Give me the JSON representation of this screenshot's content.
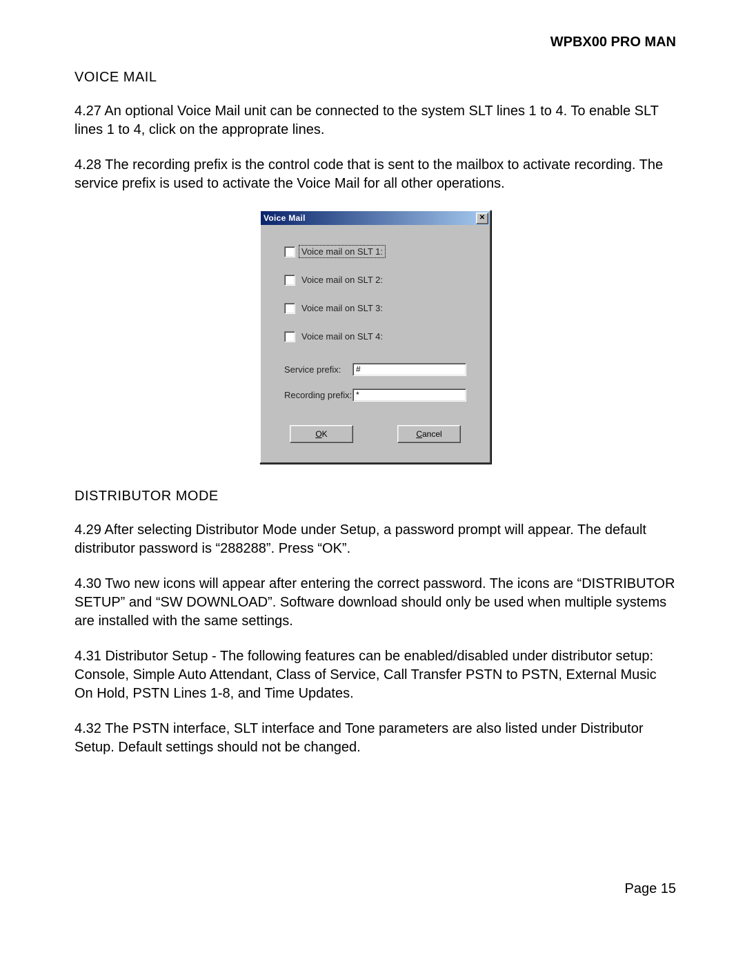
{
  "header": {
    "title": "WPBX00 PRO MAN"
  },
  "sections": {
    "voiceMail": {
      "title": "VOICE MAIL",
      "p427": "4.27    An optional Voice Mail unit can be connected to the system SLT lines 1 to 4.  To enable SLT lines 1 to 4, click on the approprate lines.",
      "p428": "4.28    The recording prefix is the control code  that is sent to the mailbox to activate recording.  The service prefix is used to activate the Voice Mail for all other operations."
    },
    "distributor": {
      "title": "DISTRIBUTOR MODE",
      "p429": "4.29    After selecting Distributor Mode under Setup, a password prompt will appear.  The default distributor password is “288288”.  Press “OK”.",
      "p430": "4.30    Two new icons will appear after entering the correct password.  The icons are “DISTRIBUTOR SETUP” and “SW DOWNLOAD”.  Software download should only be used when multiple systems are installed with the same settings.",
      "p431": "4.31    Distributor Setup - The following features can be enabled/disabled under distributor setup:  Console, Simple Auto Attendant, Class of Service, Call Transfer PSTN to PSTN, External Music On Hold, PSTN Lines 1-8, and Time Updates.",
      "p432": "4.32  The PSTN interface, SLT interface and Tone parameters are also listed under Distributor Setup.  Default settings should not be changed."
    }
  },
  "dialog": {
    "title": "Voice Mail",
    "close": "✕",
    "checkboxes": [
      {
        "label": "Voice mail on SLT 1:",
        "checked": false,
        "focused": true
      },
      {
        "label": "Voice mail on SLT 2:",
        "checked": false,
        "focused": false
      },
      {
        "label": "Voice mail on SLT 3:",
        "checked": false,
        "focused": false
      },
      {
        "label": "Voice mail on SLT 4:",
        "checked": false,
        "focused": false
      }
    ],
    "fields": {
      "service": {
        "label": "Service prefix:",
        "value": "#"
      },
      "recording": {
        "label": "Recording prefix:",
        "value": "*"
      }
    },
    "buttons": {
      "ok": {
        "accel": "O",
        "rest": "K"
      },
      "cancel": {
        "accel": "C",
        "rest": "ancel"
      }
    }
  },
  "footer": {
    "page": "Page  15"
  }
}
